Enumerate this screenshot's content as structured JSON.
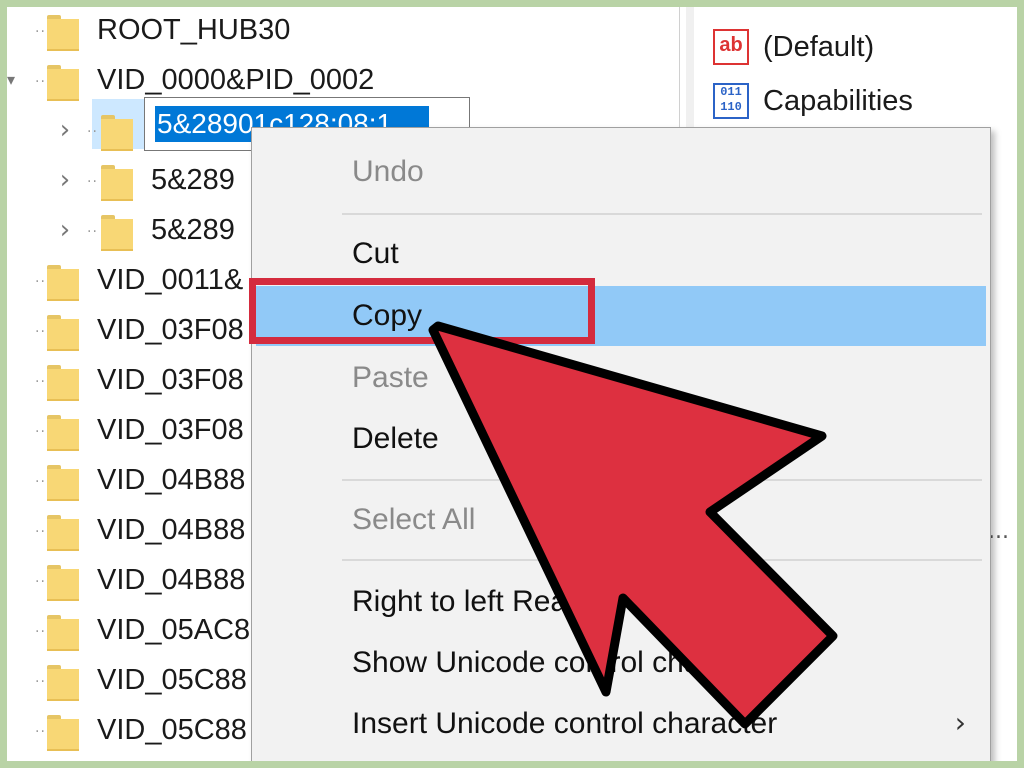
{
  "tree": {
    "nodes": [
      {
        "label": "ROOT_HUB30",
        "indent": 0,
        "expander": ""
      },
      {
        "label": "VID_0000&PID_0002",
        "indent": 0,
        "expander": "expanded"
      },
      {
        "label": "",
        "indent": 1,
        "expander": "collapsed",
        "editing": true
      },
      {
        "label": "5&289",
        "indent": 1,
        "expander": "collapsed"
      },
      {
        "label": "5&289",
        "indent": 1,
        "expander": "collapsed"
      },
      {
        "label": "VID_0011&",
        "indent": 0,
        "expander": ""
      },
      {
        "label": "VID_03F08",
        "indent": 0,
        "expander": ""
      },
      {
        "label": "VID_03F08",
        "indent": 0,
        "expander": ""
      },
      {
        "label": "VID_03F08",
        "indent": 0,
        "expander": ""
      },
      {
        "label": "VID_04B88",
        "indent": 0,
        "expander": ""
      },
      {
        "label": "VID_04B88",
        "indent": 0,
        "expander": ""
      },
      {
        "label": "VID_04B88",
        "indent": 0,
        "expander": ""
      },
      {
        "label": "VID_05AC8",
        "indent": 0,
        "expander": ""
      },
      {
        "label": "VID_05C88",
        "indent": 0,
        "expander": ""
      },
      {
        "label": "VID_05C88",
        "indent": 0,
        "expander": ""
      }
    ],
    "rename_value": "5&28901c128:08:1"
  },
  "values": {
    "items": [
      {
        "label": "(Default)",
        "icon": "string-value-icon",
        "glyph": "ab"
      },
      {
        "label": "Capabilities",
        "icon": "binary-value-icon",
        "glyph": "011\n110"
      }
    ],
    "trailing": "..."
  },
  "menu": {
    "items": [
      {
        "label": "Undo",
        "disabled": true
      },
      {
        "separator": true
      },
      {
        "label": "Cut",
        "disabled": false
      },
      {
        "label": "Copy",
        "disabled": false,
        "hover": true
      },
      {
        "label": "Paste",
        "disabled": true
      },
      {
        "label": "Delete",
        "disabled": false
      },
      {
        "separator": true
      },
      {
        "label": "Select All",
        "disabled": true
      },
      {
        "separator": true
      },
      {
        "label": "Right to left Reading order",
        "disabled": false
      },
      {
        "label": "Show Unicode control characters",
        "disabled": false
      },
      {
        "label": "Insert Unicode control character",
        "disabled": false,
        "submenu": true
      }
    ],
    "submenu_arrow": "›"
  },
  "annotation": {
    "highlight_color": "#d42b3e",
    "pointer_color": "#dd3040"
  }
}
